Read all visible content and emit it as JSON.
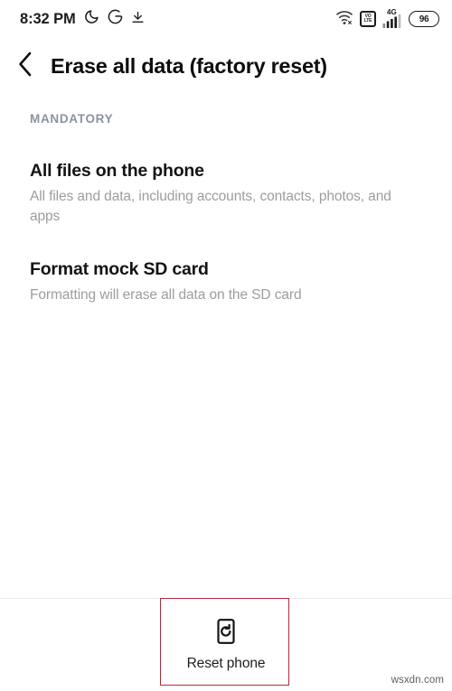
{
  "status_bar": {
    "clock": "8:32 PM",
    "left_icons": [
      {
        "name": "do-not-disturb-moon-icon",
        "glyph": "moon"
      },
      {
        "name": "google-g-icon",
        "glyph": "G"
      },
      {
        "name": "download-icon",
        "glyph": "download"
      }
    ],
    "right_icons": [
      {
        "name": "wifi-icon",
        "glyph": "wifi"
      },
      {
        "name": "volte-icon",
        "line1": "VO",
        "line2": "LTE"
      },
      {
        "name": "cellular-signal-icon",
        "network_label": "4G"
      }
    ],
    "battery_level": "96"
  },
  "app_bar": {
    "back_icon": "chevron-left-icon",
    "title": "Erase all data (factory reset)"
  },
  "section": {
    "header": "MANDATORY"
  },
  "items": [
    {
      "title": "All files on the phone",
      "subtitle": "All files and data, including accounts, contacts, photos, and apps"
    },
    {
      "title": "Format mock SD card",
      "subtitle": "Formatting will erase all data on the SD card"
    }
  ],
  "bottom_bar": {
    "reset_icon": "phone-reset-icon",
    "reset_label": "Reset phone"
  },
  "annotation": {
    "color": "#b02a3a"
  },
  "watermark": "wsxdn.com"
}
